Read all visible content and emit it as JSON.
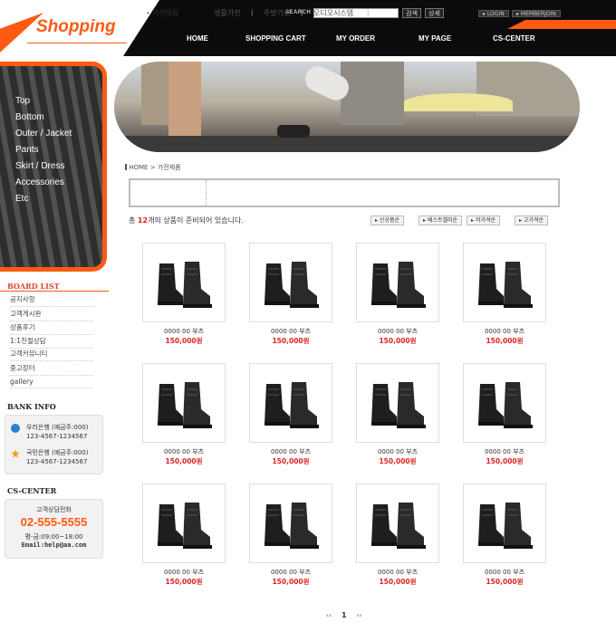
{
  "brand": {
    "logo": "Shopping"
  },
  "header": {
    "search_label": "SEARCH",
    "search_btn": "검색",
    "detail_btn": "상세",
    "login": "LOGIN",
    "member_join": "MEMBERJOIN",
    "nav": [
      "HOME",
      "SHOPPING CART",
      "MY ORDER",
      "MY PAGE",
      "CS-CENTER"
    ]
  },
  "categories": [
    "Top",
    "Bottom",
    "Outer / Jacket",
    "Pants",
    "Skirt / Dress",
    "Accessories",
    "Etc"
  ],
  "board": {
    "title": "BOARD LIST",
    "items": [
      "공지사항",
      "고객게시판",
      "상품후기",
      "1:1친절상담",
      "고객커뮤니티",
      "중고장터",
      "gallery"
    ]
  },
  "bank": {
    "title": "BANK INFO",
    "accounts": [
      {
        "name": "우리은행 (예금주:000)",
        "number": "123-4567-1234567"
      },
      {
        "name": "국민은행 (예금주:000)",
        "number": "123-4567-1234567"
      }
    ]
  },
  "cs": {
    "title": "CS-CENTER",
    "label": "고객상담전화",
    "phone": "02-555-5555",
    "hours": "평-금:09:00~18:00",
    "email": "Email:help@aa.com"
  },
  "breadcrumb": {
    "home": "HOME",
    "current": "가전제품"
  },
  "tabs": [
    "가전제품",
    "생활가전",
    "주방가전",
    "오디오시스템"
  ],
  "listing": {
    "count_prefix": "총",
    "count": "12",
    "count_suffix": "개의 상품이 준비되어 있습니다.",
    "sort": [
      "신상품순",
      "베스트셀러순",
      "저가격순",
      "고가격순"
    ]
  },
  "products": [
    {
      "name": "0000 00 부츠",
      "price": "150,000원"
    },
    {
      "name": "0000 00 부츠",
      "price": "150,000원"
    },
    {
      "name": "0000 00 부츠",
      "price": "150,000원"
    },
    {
      "name": "0000 00 부츠",
      "price": "150,000원"
    },
    {
      "name": "0000 00 부츠",
      "price": "150,000원"
    },
    {
      "name": "0000 00 부츠",
      "price": "150,000원"
    },
    {
      "name": "0000 00 부츠",
      "price": "150,000원"
    },
    {
      "name": "0000 00 부츠",
      "price": "150,000원"
    },
    {
      "name": "0000 00 부츠",
      "price": "150,000원"
    },
    {
      "name": "0000 00 부츠",
      "price": "150,000원"
    },
    {
      "name": "0000 00 부츠",
      "price": "150,000원"
    },
    {
      "name": "0000 00 부츠",
      "price": "150,000원"
    }
  ],
  "pagination": {
    "prev": "‹‹",
    "current": "1",
    "next": "››"
  },
  "colors": {
    "accent": "#ff5a14",
    "price": "#dd2222",
    "header_bg": "#0b0b0b"
  }
}
